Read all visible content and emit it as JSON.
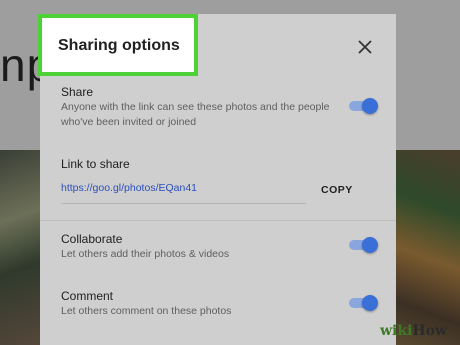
{
  "background": {
    "title_fragment": "np"
  },
  "dialog": {
    "title": "Sharing options",
    "highlight_color": "#4cd137",
    "close_icon": "close-icon",
    "share": {
      "label": "Share",
      "description": "Anyone with the link can see these photos and the people who've been invited or joined",
      "enabled": true
    },
    "link": {
      "label": "Link to share",
      "url": "https://goo.gl/photos/EQan41",
      "copy_label": "COPY"
    },
    "collaborate": {
      "label": "Collaborate",
      "description": "Let others add their photos & videos",
      "enabled": true
    },
    "comment": {
      "label": "Comment",
      "description": "Let others comment on these photos",
      "enabled": true
    },
    "toggle_color": "#3a6fd8",
    "link_color": "#2b4fbf"
  },
  "watermark": {
    "wiki": "wiki",
    "how": "How"
  }
}
